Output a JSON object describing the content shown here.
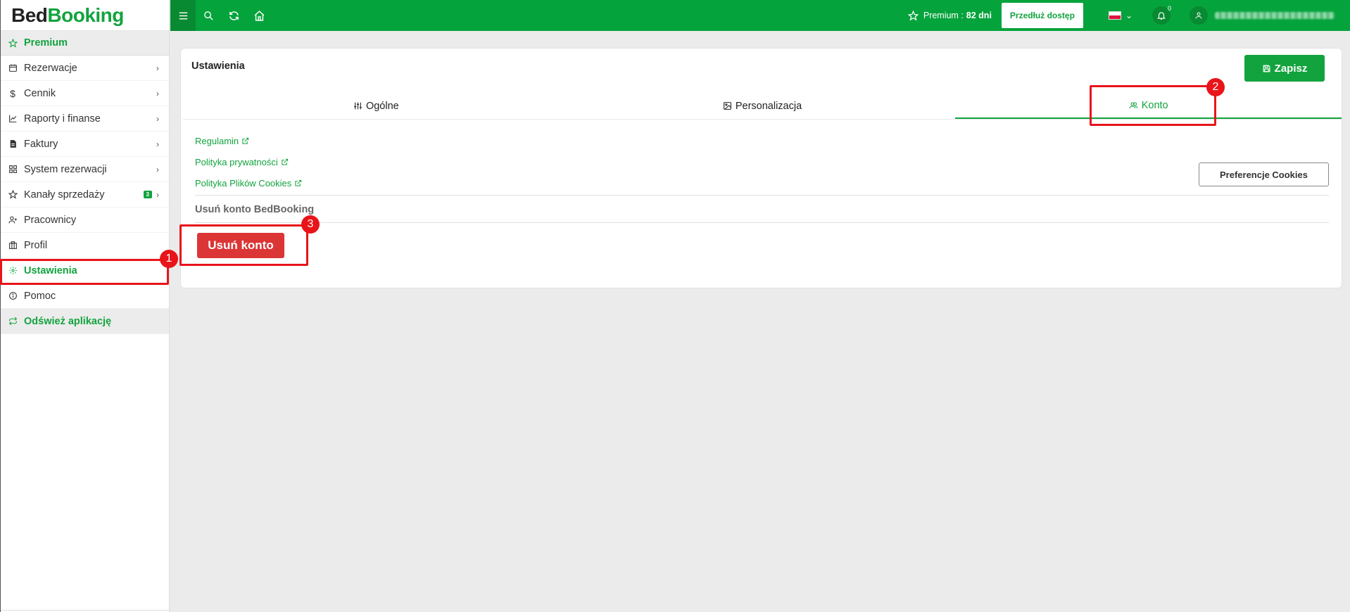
{
  "logo": {
    "part1": "Bed",
    "part2": "Booking"
  },
  "sidebar": {
    "items": [
      {
        "label": "Premium",
        "icon": "star-icon"
      },
      {
        "label": "Rezerwacje",
        "icon": "calendar-icon"
      },
      {
        "label": "Cennik",
        "icon": "dollar-icon"
      },
      {
        "label": "Raporty i finanse",
        "icon": "chart-icon"
      },
      {
        "label": "Faktury",
        "icon": "invoice-icon"
      },
      {
        "label": "System rezerwacji",
        "icon": "grid-icon"
      },
      {
        "label": "Kanały sprzedaży",
        "icon": "star-icon",
        "badge": "3"
      },
      {
        "label": "Pracownicy",
        "icon": "users-icon"
      },
      {
        "label": "Profil",
        "icon": "building-icon"
      },
      {
        "label": "Ustawienia",
        "icon": "gear-icon"
      },
      {
        "label": "Pomoc",
        "icon": "info-icon"
      },
      {
        "label": "Odśwież aplikację",
        "icon": "refresh-icon"
      }
    ]
  },
  "topbar": {
    "premium_label": "Premium :",
    "premium_days": "82 dni",
    "extend_label": "Przedłuż dostęp",
    "notifications_count": "0"
  },
  "page": {
    "title": "Ustawienia",
    "save_label": "Zapisz",
    "tabs": [
      {
        "label": "Ogólne",
        "icon": "sliders-icon"
      },
      {
        "label": "Personalizacja",
        "icon": "image-icon"
      },
      {
        "label": "Konto",
        "icon": "users-icon"
      }
    ],
    "links": [
      "Regulamin",
      "Polityka prywatności",
      "Polityka Plików Cookies"
    ],
    "cookie_prefs_label": "Preferencje Cookies",
    "delete_section_title": "Usuń konto BedBooking",
    "delete_button_label": "Usuń konto"
  },
  "annotations": [
    "1",
    "2",
    "3"
  ],
  "colors": {
    "brand": "#05a33c",
    "danger": "#dc3535",
    "annotation": "#e8141a"
  }
}
